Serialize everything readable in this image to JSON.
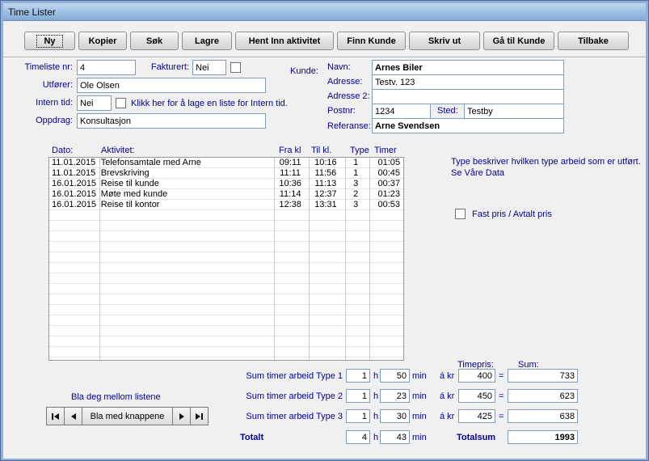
{
  "colors": {
    "label_blue": "#000099",
    "value_red": "#CC0000",
    "titlebar_blue": "#84A9D2"
  },
  "window": {
    "title": "Time Lister"
  },
  "toolbar": {
    "buttons": [
      "Ny",
      "Kopier",
      "Søk",
      "Lagre",
      "Hent Inn aktivitet",
      "Finn Kunde",
      "Skriv ut",
      "Gå til Kunde",
      "Tilbake"
    ]
  },
  "form": {
    "timeliste_label": "Timeliste nr:",
    "timeliste_value": "4",
    "fakturert_label": "Fakturert:",
    "fakturert_value": "Nei",
    "utforer_label": "Utfører:",
    "utforer_value": "Ole Olsen",
    "intern_label": "Intern tid:",
    "intern_value": "Nei",
    "intern_hint": "Klikk her for å lage en liste for Intern tid.",
    "oppdrag_label": "Oppdrag:",
    "oppdrag_value": "Konsultasjon"
  },
  "kunde": {
    "kunde_label": "Kunde:",
    "navn_label": "Navn:",
    "navn_value": "Arnes Biler",
    "adresse_label": "Adresse:",
    "adresse_value": "Testv. 123",
    "adresse2_label": "Adresse 2:",
    "adresse2_value": "",
    "postnr_label": "Postnr:",
    "postnr_value": "1234",
    "sted_label": "Sted:",
    "sted_value": "Testby",
    "referanse_label": "Referanse:",
    "referanse_value": "Arne Svendsen"
  },
  "table": {
    "headers": {
      "dato": "Dato:",
      "aktivitet": "Aktivitet:",
      "fra": "Fra kl",
      "til": "Til kl.",
      "type": "Type",
      "timer": "Timer"
    },
    "rows": [
      {
        "dato": "11.01.2015",
        "aktivitet": "Telefonsamtale med Arne",
        "fra": "09:11",
        "til": "10:16",
        "type": "1",
        "timer": "01:05"
      },
      {
        "dato": "11.01.2015",
        "aktivitet": "Brevskriving",
        "fra": "11:11",
        "til": "11:56",
        "type": "1",
        "timer": "00:45"
      },
      {
        "dato": "16.01.2015",
        "aktivitet": "Reise til kunde",
        "fra": "10:36",
        "til": "11:13",
        "type": "3",
        "timer": "00:37"
      },
      {
        "dato": "16.01.2015",
        "aktivitet": "Møte med kunde",
        "fra": "11:14",
        "til": "12:37",
        "type": "2",
        "timer": "01:23"
      },
      {
        "dato": "16.01.2015",
        "aktivitet": "Reise til kontor",
        "fra": "12:38",
        "til": "13:31",
        "type": "3",
        "timer": "00:53"
      }
    ]
  },
  "info": {
    "type_hint": "Type beskriver hvilken type arbeid som er utført. Se Våre Data",
    "fastpris_label": "Fast pris / Avtalt pris"
  },
  "sums": {
    "timepris_label": "Timepris:",
    "sum_label": "Sum:",
    "h_label": "h",
    "min_label": "min",
    "akr_label": "á kr",
    "eq_label": "=",
    "rows": [
      {
        "label": "Sum timer arbeid Type 1",
        "h": "1",
        "min": "50",
        "pris": "400",
        "sum": "733"
      },
      {
        "label": "Sum timer arbeid Type 2",
        "h": "1",
        "min": "23",
        "pris": "450",
        "sum": "623"
      },
      {
        "label": "Sum timer arbeid Type 3",
        "h": "1",
        "min": "30",
        "pris": "425",
        "sum": "638"
      }
    ],
    "totalt_label": "Totalt",
    "total_h": "4",
    "total_min": "43",
    "totalsum_label": "Totalsum",
    "totalsum_value": "1993"
  },
  "nav": {
    "hint": "Bla deg mellom listene",
    "button_label": "Bla med knappene"
  }
}
